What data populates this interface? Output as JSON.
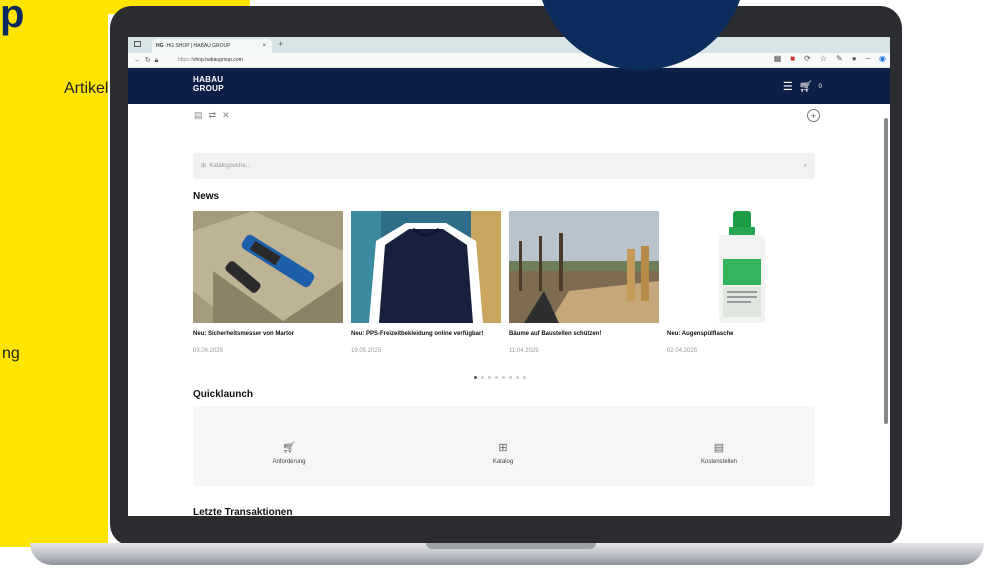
{
  "backdrop": {
    "header_glyph": "p",
    "side_texts": [
      "Artikel",
      "ng"
    ]
  },
  "browser": {
    "tab_favicon": "HG",
    "tab_title": "HG SHOP | HABAU GROUP",
    "tab_close": "×",
    "new_tab": "+",
    "url_protocol": "https://",
    "url_host": "shop.habaugroup.com"
  },
  "site": {
    "logo_line1": "HABAU",
    "logo_line2": "GROUP",
    "cart_count": "0",
    "search_placeholder": "Katalogsuche...",
    "news_title": "News",
    "news": [
      {
        "title": "Neu: Sicherheitsmesser von Martor",
        "date": "03.06.2025"
      },
      {
        "title": "Neu: PPS-Freizeitbekleidung online verfügbar!",
        "date": "19.05.2025"
      },
      {
        "title": "Bäume auf Baustellen schützen!",
        "date": "11.04.2025"
      },
      {
        "title": "Neu: Augenspülflasche",
        "date": "02.04.2025"
      }
    ],
    "quicklaunch_title": "Quicklaunch",
    "quicklaunch": [
      {
        "label": "Anforderung",
        "icon": "cart-icon"
      },
      {
        "label": "Katalog",
        "icon": "grid-icon"
      },
      {
        "label": "Kostenstellen",
        "icon": "table-icon"
      }
    ],
    "transactions_title": "Letzte Transaktionen"
  },
  "colors": {
    "brand_yellow": "#ffe500",
    "brand_navy": "#0d1f47",
    "circle_blue": "#0c2c5e"
  }
}
